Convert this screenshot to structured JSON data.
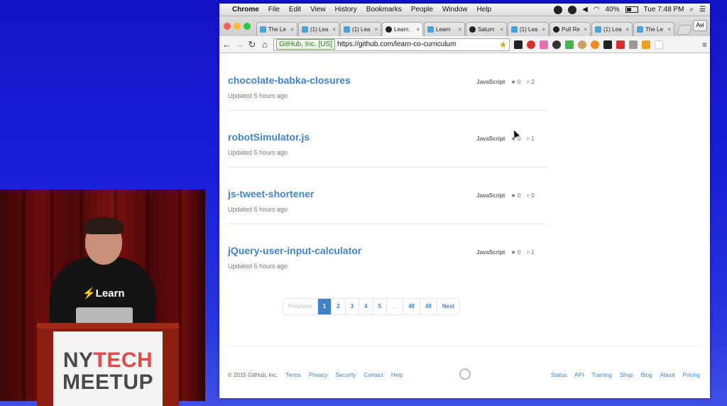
{
  "video": {
    "shirt_logo": "⚡Learn",
    "podium_sign": {
      "ny": "NY",
      "tech": "TECH",
      "meetup": "MEETUP"
    }
  },
  "menubar": {
    "apple_icon": "apple-icon",
    "items": [
      "Chrome",
      "File",
      "Edit",
      "View",
      "History",
      "Bookmarks",
      "People",
      "Window",
      "Help"
    ],
    "battery": "40%",
    "clock": "Tue 7:48 PM"
  },
  "tabs": [
    {
      "label": "The Le",
      "icon": "learn-favicon"
    },
    {
      "label": "(1) Lea",
      "icon": "learn-favicon"
    },
    {
      "label": "(1) Lea",
      "icon": "learn-favicon"
    },
    {
      "label": "Learn.",
      "icon": "github-favicon",
      "active": true
    },
    {
      "label": "Learn",
      "icon": "learn-favicon"
    },
    {
      "label": "Saturn",
      "icon": "github-favicon"
    },
    {
      "label": "(1) Lea",
      "icon": "learn-favicon"
    },
    {
      "label": "Pull Re",
      "icon": "github-favicon"
    },
    {
      "label": "(1) Lea",
      "icon": "learn-favicon"
    },
    {
      "label": "The Le",
      "icon": "learn-favicon"
    }
  ],
  "profile_button": "Avi",
  "address": {
    "ev_badge": "GitHub, Inc. [US]",
    "url": "https://github.com/learn-co-curriculum"
  },
  "repos": [
    {
      "name": "chocolate-babka-closures",
      "updated": "Updated 5 hours ago",
      "language": "JavaScript",
      "stars": "★ 0",
      "forks": "⑂ 2"
    },
    {
      "name": "robotSimulator.js",
      "updated": "Updated 5 hours ago",
      "language": "JavaScript",
      "stars": "★ 0",
      "forks": "⑂ 1"
    },
    {
      "name": "js-tweet-shortener",
      "updated": "Updated 5 hours ago",
      "language": "JavaScript",
      "stars": "★ 0",
      "forks": "⑂ 0"
    },
    {
      "name": "jQuery-user-input-calculator",
      "updated": "Updated 5 hours ago",
      "language": "JavaScript",
      "stars": "★ 0",
      "forks": "⑂ 1"
    }
  ],
  "pagination": {
    "previous": "Previous",
    "pages": [
      "1",
      "2",
      "3",
      "4",
      "5",
      "…",
      "48",
      "49"
    ],
    "current": "1",
    "next": "Next"
  },
  "footer": {
    "copyright": "© 2015 GitHub, Inc.",
    "left_links": [
      "Terms",
      "Privacy",
      "Security",
      "Contact",
      "Help"
    ],
    "right_links": [
      "Status",
      "API",
      "Training",
      "Shop",
      "Blog",
      "About",
      "Pricing"
    ]
  },
  "colors": {
    "link": "#4183c4",
    "background": "#1a20d8",
    "podium": "#8a1e10",
    "tech_red": "#e04a4a"
  }
}
